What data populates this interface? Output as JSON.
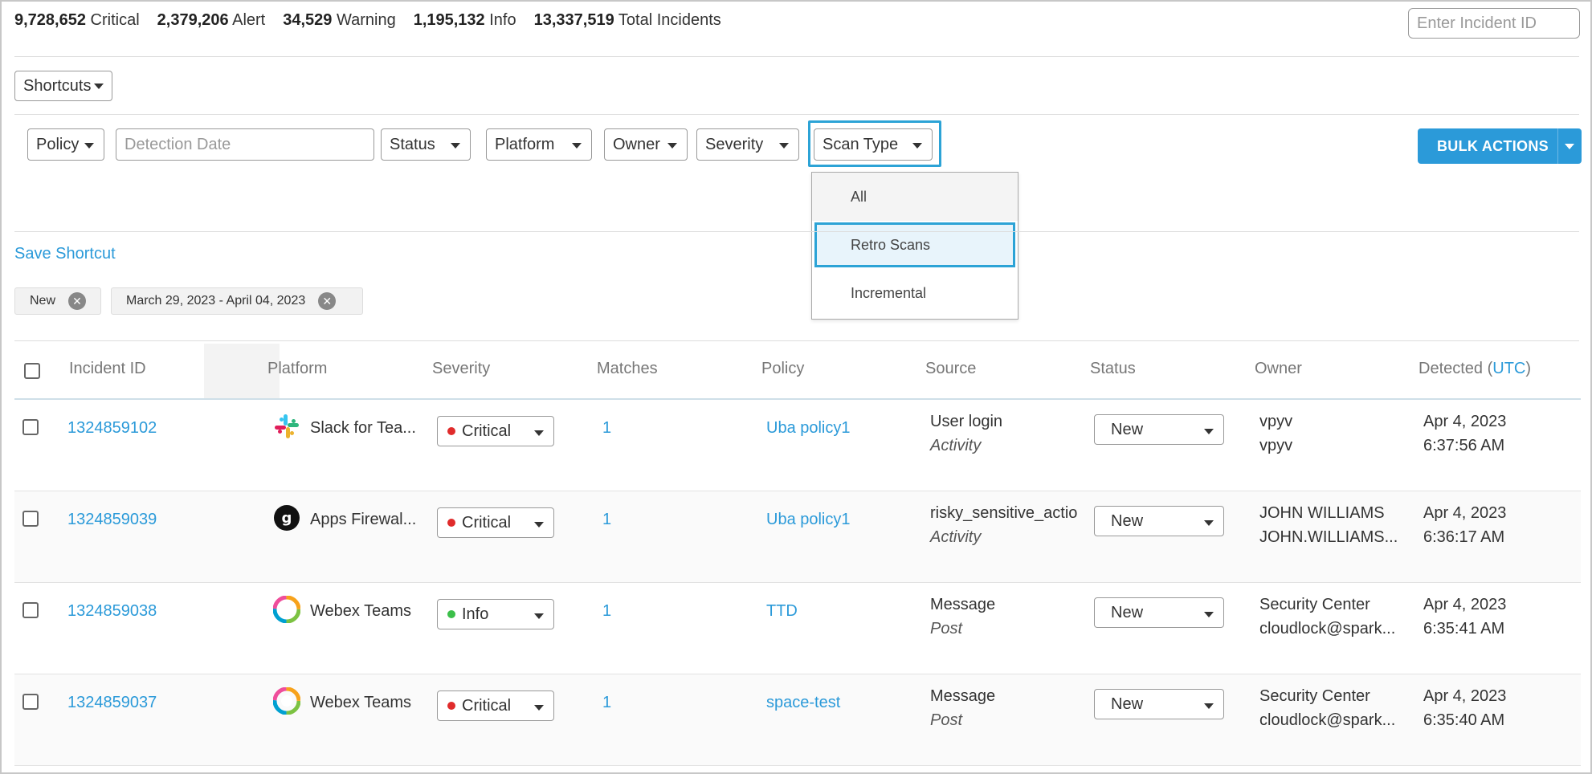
{
  "summary": {
    "critical_count": "9,728,652",
    "critical_label": "Critical",
    "alert_count": "2,379,206",
    "alert_label": "Alert",
    "warning_count": "34,529",
    "warning_label": "Warning",
    "info_count": "1,195,132",
    "info_label": "Info",
    "total_count": "13,337,519",
    "total_label": "Total Incidents"
  },
  "incident_search": {
    "placeholder": "Enter Incident ID"
  },
  "shortcuts": {
    "label": "Shortcuts"
  },
  "filters": {
    "policy": "Policy",
    "detection_date_placeholder": "Detection Date",
    "status": "Status",
    "platform": "Platform",
    "owner": "Owner",
    "severity": "Severity",
    "scan_type": "Scan Type"
  },
  "bulk_actions": {
    "label": "BULK ACTIONS"
  },
  "scan_type_menu": {
    "options": [
      "All",
      "Retro Scans",
      "Incremental"
    ],
    "highlighted": "Retro Scans"
  },
  "save_shortcut": "Save Shortcut",
  "active_filters": [
    "New",
    "March 29, 2023 - April 04, 2023"
  ],
  "table": {
    "headers": {
      "incident_id": "Incident ID",
      "platform": "Platform",
      "severity": "Severity",
      "matches": "Matches",
      "policy": "Policy",
      "source": "Source",
      "status": "Status",
      "owner": "Owner",
      "detected": "Detected (",
      "detected_tz": "UTC",
      "detected_close": ")"
    },
    "rows": [
      {
        "id": "1324859102",
        "platform": "Slack for Tea...",
        "platform_icon": "slack-icon",
        "severity": "Critical",
        "severity_color": "#e02b2b",
        "matches": "1",
        "policy": "Uba policy1",
        "source_main": "User login",
        "source_type": "Activity",
        "status": "New",
        "owner_name": "vpyv",
        "owner_email": "vpyv",
        "detected_date": "Apr 4, 2023",
        "detected_time": "6:37:56 AM"
      },
      {
        "id": "1324859039",
        "platform": "Apps Firewal...",
        "platform_icon": "apps-firewall-icon",
        "severity": "Critical",
        "severity_color": "#e02b2b",
        "matches": "1",
        "policy": "Uba policy1",
        "source_main": "risky_sensitive_actio",
        "source_type": "Activity",
        "status": "New",
        "owner_name": "JOHN WILLIAMS",
        "owner_email": "JOHN.WILLIAMS...",
        "detected_date": "Apr 4, 2023",
        "detected_time": "6:36:17 AM"
      },
      {
        "id": "1324859038",
        "platform": "Webex Teams",
        "platform_icon": "webex-icon",
        "severity": "Info",
        "severity_color": "#3cbf4a",
        "matches": "1",
        "policy": "TTD",
        "source_main": "Message",
        "source_type": "Post",
        "status": "New",
        "owner_name": "Security Center",
        "owner_email": "cloudlock@spark...",
        "detected_date": "Apr 4, 2023",
        "detected_time": "6:35:41 AM"
      },
      {
        "id": "1324859037",
        "platform": "Webex Teams",
        "platform_icon": "webex-icon",
        "severity": "Critical",
        "severity_color": "#e02b2b",
        "matches": "1",
        "policy": "space-test",
        "source_main": "Message",
        "source_type": "Post",
        "status": "New",
        "owner_name": "Security Center",
        "owner_email": "cloudlock@spark...",
        "detected_date": "Apr 4, 2023",
        "detected_time": "6:35:40 AM"
      }
    ]
  },
  "colors": {
    "accent": "#2b9ad9",
    "critical": "#e02b2b",
    "info": "#3cbf4a"
  }
}
